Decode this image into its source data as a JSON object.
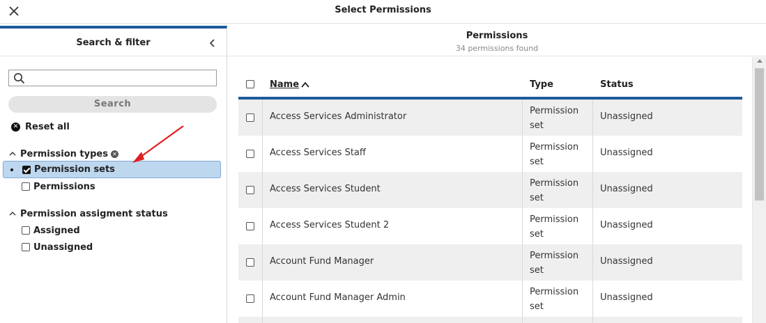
{
  "modal": {
    "title": "Select Permissions"
  },
  "filters": {
    "title": "Search & filter",
    "search_placeholder": "",
    "search_button": "Search",
    "reset_all": "Reset all",
    "groups": [
      {
        "label": "Permission types",
        "options": [
          {
            "label": "Permission sets",
            "checked": true
          },
          {
            "label": "Permissions",
            "checked": false
          }
        ]
      },
      {
        "label": "Permission assigment status",
        "options": [
          {
            "label": "Assigned",
            "checked": false
          },
          {
            "label": "Unassigned",
            "checked": false
          }
        ]
      }
    ]
  },
  "results": {
    "title": "Permissions",
    "count_text": "34 permissions found",
    "columns": {
      "name": "Name",
      "type": "Type",
      "status": "Status"
    },
    "rows": [
      {
        "name": "Access Services Administrator",
        "type": "Permission set",
        "status": "Unassigned"
      },
      {
        "name": "Access Services Staff",
        "type": "Permission set",
        "status": "Unassigned"
      },
      {
        "name": "Access Services Student",
        "type": "Permission set",
        "status": "Unassigned"
      },
      {
        "name": "Access Services Student 2",
        "type": "Permission set",
        "status": "Unassigned"
      },
      {
        "name": "Account Fund Manager",
        "type": "Permission set",
        "status": "Unassigned"
      },
      {
        "name": "Account Fund Manager Admin",
        "type": "Permission set",
        "status": "Unassigned"
      }
    ]
  },
  "colors": {
    "accent": "#1d5b9a",
    "selected_bg": "#bdd7ef",
    "arrow": "#e02020"
  }
}
